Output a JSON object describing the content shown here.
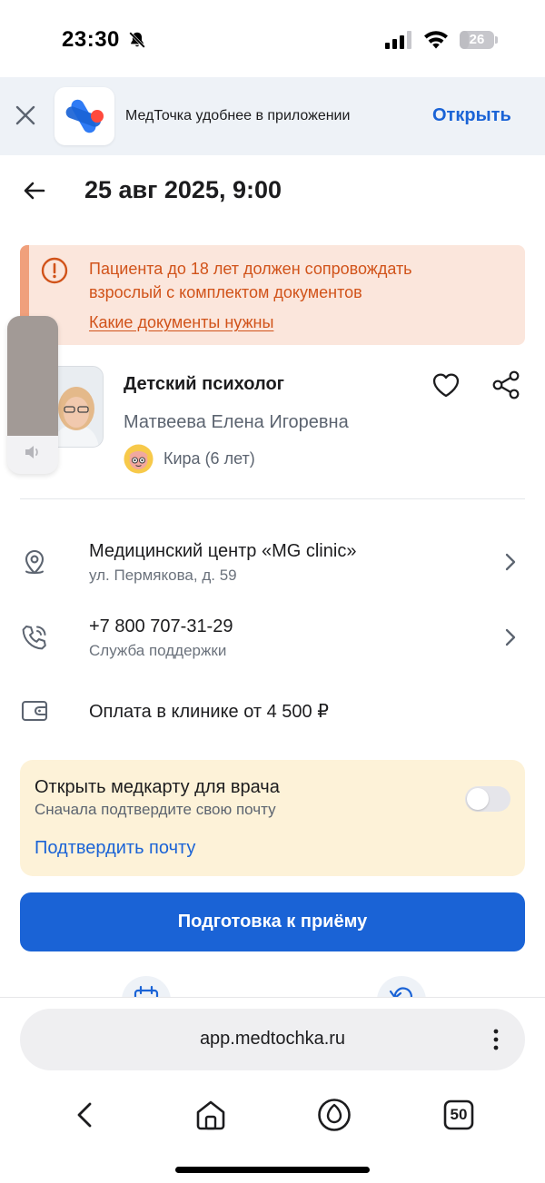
{
  "status_bar": {
    "time": "23:30",
    "battery": "26",
    "battery_level": 0.26
  },
  "app_banner": {
    "text": "МедТочка удобнее в приложении",
    "open_label": "Открыть"
  },
  "header": {
    "title": "25 авг 2025, 9:00"
  },
  "warning": {
    "text": "Пациента до 18 лет должен сопровождать взрослый с комплектом документов",
    "link": "Какие документы нужны"
  },
  "doctor": {
    "specialty": "Детский психолог",
    "name": "Матвеева Елена Игоревна",
    "patient": "Кира (6 лет)"
  },
  "info": {
    "clinic": {
      "title": "Медицинский центр «MG clinic»",
      "address": "ул. Пермякова, д. 59"
    },
    "phone": {
      "number": "+7 800 707-31-29",
      "label": "Служба поддержки"
    },
    "payment": {
      "text": "Оплата в клинике от 4 500 ₽"
    }
  },
  "medcard": {
    "title": "Открыть медкарту для врача",
    "subtitle": "Сначала подтвердите свою почту",
    "link": "Подтвердить почту",
    "toggle_on": false
  },
  "actions": {
    "prepare_label": "Подготовка к приёму"
  },
  "browser": {
    "url": "app.medtochka.ru",
    "tabs_count": "50"
  },
  "colors": {
    "accent": "#1a63d6",
    "warning_text": "#d1531a",
    "warning_bg": "#fbe6dc",
    "medcard_bg": "#fdf2d8"
  }
}
